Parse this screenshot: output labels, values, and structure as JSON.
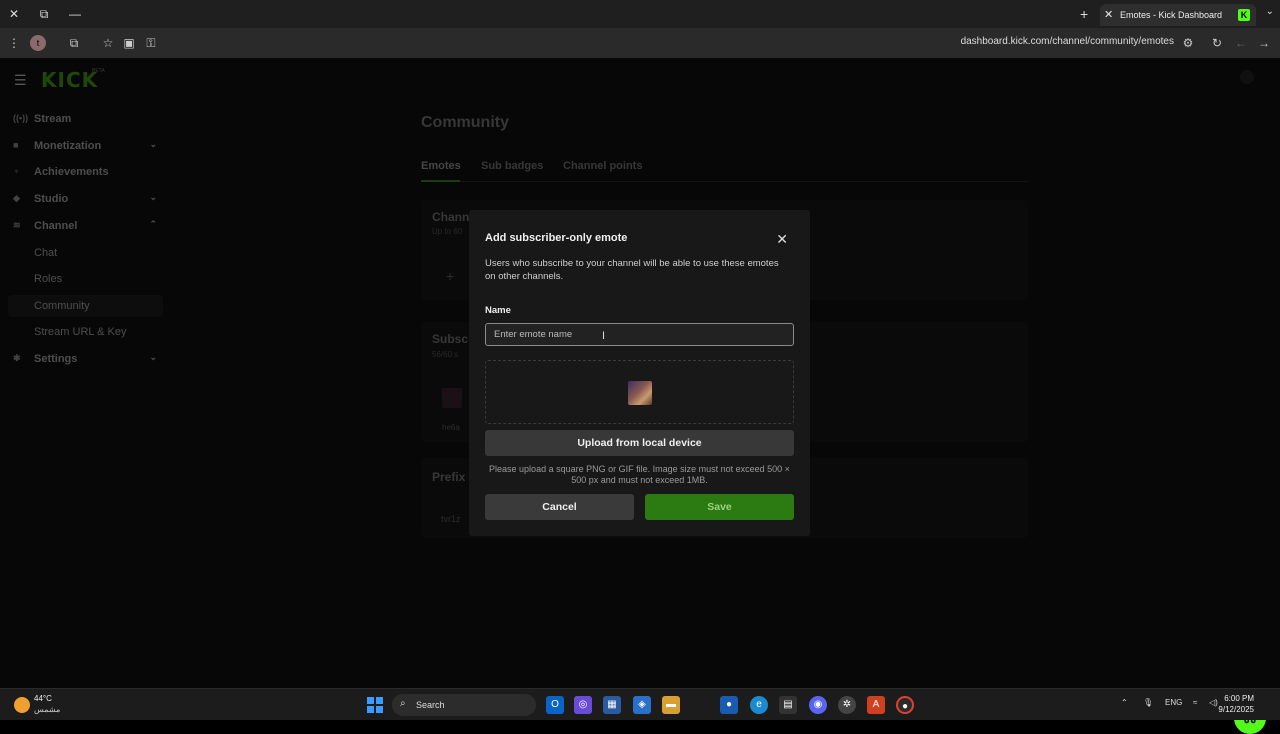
{
  "browser": {
    "tab_title": "Emotes - Kick Dashboard",
    "tab_favicon": "K",
    "url": "dashboard.kick.com/channel/community/emotes",
    "profile_initial": "t"
  },
  "app": {
    "logo": "KICK",
    "logo_sub": "BETA",
    "nav": {
      "stream": "Stream",
      "monetization": "Monetization",
      "achievements": "Achievements",
      "studio": "Studio",
      "channel": "Channel",
      "chat": "Chat",
      "roles": "Roles",
      "community": "Community",
      "stream_url_key": "Stream URL & Key",
      "settings": "Settings"
    },
    "page_title": "Community",
    "tabs": {
      "emotes": "Emotes",
      "sub_badges": "Sub badges",
      "channel_points": "Channel points"
    },
    "bg": {
      "channel_title": "Chann",
      "channel_sub": "Up to 60",
      "subscriber_title": "Subsc",
      "subscriber_sub": "56/60 s",
      "emote_name": "he6a",
      "prefix_title": "Prefix",
      "prefix_value": "tvr1z"
    }
  },
  "modal": {
    "title": "Add subscriber-only emote",
    "description": "Users who subscribe to your channel will be able to use these emotes on other channels.",
    "name_label": "Name",
    "name_placeholder": "Enter emote name",
    "name_value": "",
    "upload_button": "Upload from local device",
    "note": "Please upload a square PNG or GIF file. Image size must not exceed 500 × 500 px and must not exceed 1MB.",
    "cancel": "Cancel",
    "save": "Save"
  },
  "taskbar": {
    "weather_temp": "44°C",
    "weather_desc": "مشمس",
    "search": "Search",
    "lang": "ENG",
    "time": "6:00 PM",
    "date": "9/12/2025"
  },
  "colors": {
    "accent": "#53fc18",
    "save_button": "#2b7a12"
  }
}
